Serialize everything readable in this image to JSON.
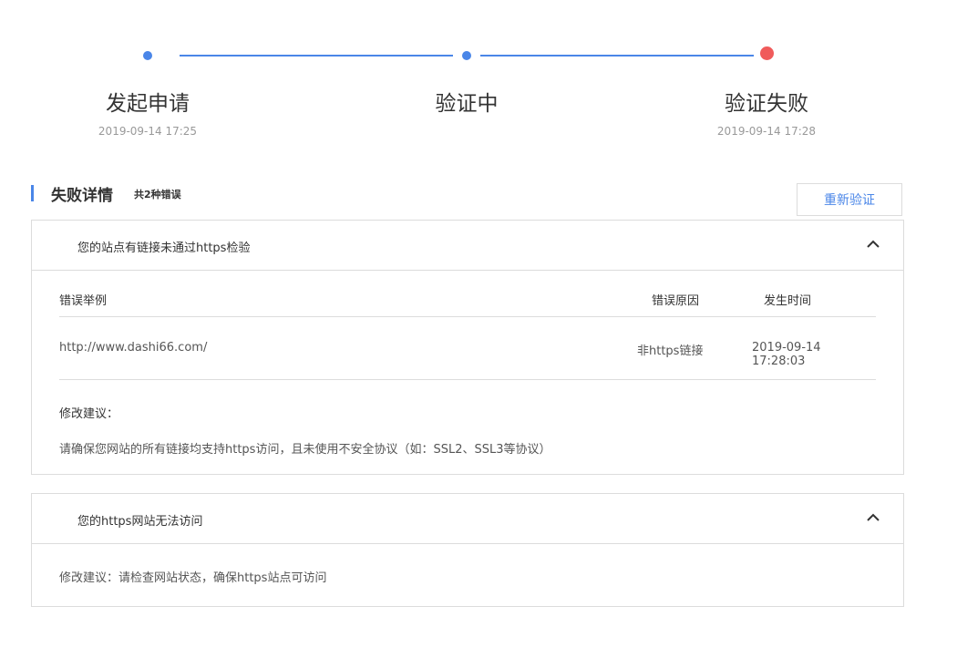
{
  "steps": [
    {
      "title": "发起申请",
      "time": "2019-09-14 17:25",
      "status": "done",
      "color": "#4a86e8"
    },
    {
      "title": "验证中",
      "time": "",
      "status": "done",
      "color": "#4a86e8"
    },
    {
      "title": "验证失败",
      "time": "2019-09-14 17:28",
      "status": "failed",
      "color": "#f05b5b"
    }
  ],
  "section": {
    "title": "失败详情",
    "count": "共2种错误",
    "retry_label": "重新验证"
  },
  "panel1": {
    "title": "您的站点有链接未通过https检验",
    "columns": [
      "错误举例",
      "错误原因",
      "发生时间"
    ],
    "rows": [
      {
        "example": "http://www.dashi66.com/",
        "reason": "非https链接",
        "time": "2019-09-14 17:28:03"
      }
    ],
    "advice_label": "修改建议：",
    "advice_text": "请确保您网站的所有链接均支持https访问，且未使用不安全协议（如：SSL2、SSL3等协议）"
  },
  "panel2": {
    "title": "您的https网站无法访问",
    "advice": "修改建议：请检查网站状态，确保https站点可访问"
  },
  "colors": {
    "accent": "#4a86e8",
    "error": "#f05b5b"
  }
}
